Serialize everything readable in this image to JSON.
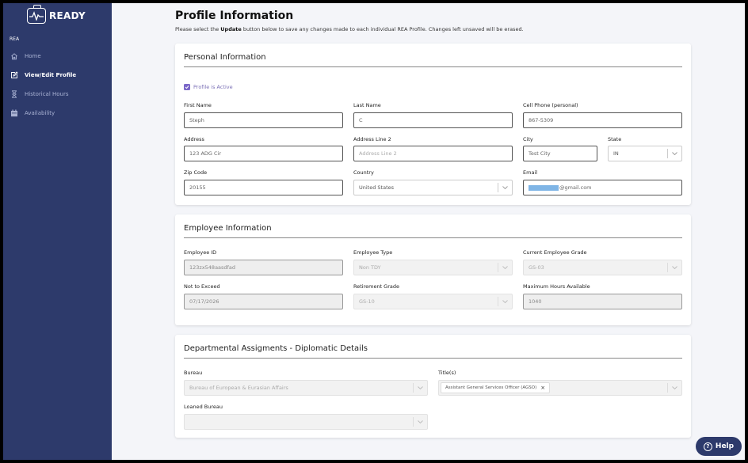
{
  "app": {
    "name": "READY"
  },
  "sidebar": {
    "section": "REA",
    "items": [
      {
        "label": "Home",
        "icon": "home-icon"
      },
      {
        "label": "View/Edit Profile",
        "icon": "edit-icon",
        "active": true
      },
      {
        "label": "Historical Hours",
        "icon": "hourglass-icon"
      },
      {
        "label": "Availability",
        "icon": "calendar-icon"
      }
    ]
  },
  "page": {
    "title": "Profile Information",
    "subtitle_before": "Please select the ",
    "subtitle_bold": "Update",
    "subtitle_after": " button below to save any changes made to each individual REA Profile. Changes left unsaved will be erased."
  },
  "personal": {
    "title": "Personal Information",
    "active_label": "Profile is Active",
    "active_checked": true,
    "first_name": {
      "label": "First Name",
      "value": "Steph"
    },
    "last_name": {
      "label": "Last Name",
      "value": "C"
    },
    "cell_phone": {
      "label": "Cell Phone (personal)",
      "value": "867-5309"
    },
    "address": {
      "label": "Address",
      "value": "123 ADG Cir"
    },
    "address2": {
      "label": "Address Line 2",
      "placeholder": "Address Line 2"
    },
    "city": {
      "label": "City",
      "value": "Test City"
    },
    "state": {
      "label": "State",
      "value": "IN"
    },
    "zip": {
      "label": "Zip Code",
      "value": "20155"
    },
    "country": {
      "label": "Country",
      "value": "United States"
    },
    "email": {
      "label": "Email",
      "value": "@gmail.com"
    }
  },
  "employee": {
    "title": "Employee Information",
    "employee_id": {
      "label": "Employee ID",
      "value": "123zx548aasdfad"
    },
    "employee_type": {
      "label": "Employee Type",
      "value": "Non TDY"
    },
    "current_grade": {
      "label": "Current Employee Grade",
      "value": "GS-03"
    },
    "not_to_exceed": {
      "label": "Not to Exceed",
      "value": "07/17/2026"
    },
    "retirement_grade": {
      "label": "Retirement Grade",
      "value": "GS-10"
    },
    "max_hours": {
      "label": "Maximum Hours Available",
      "value": "1040"
    }
  },
  "departmental": {
    "title": "Departmental Assigments - Diplomatic Details",
    "bureau": {
      "label": "Bureau",
      "value": "Bureau of European & Eurasian Affairs"
    },
    "titles": {
      "label": "Title(s)",
      "chips": [
        "Assistant General Services Officer (AGSO)"
      ],
      "chip_remove": "×"
    },
    "loaned_bureau": {
      "label": "Loaned Bureau",
      "value": ""
    }
  },
  "help": {
    "label": "Help",
    "icon_glyph": "?"
  },
  "colors": {
    "sidebar": "#2d3a6b",
    "accent": "#7b68c8"
  }
}
